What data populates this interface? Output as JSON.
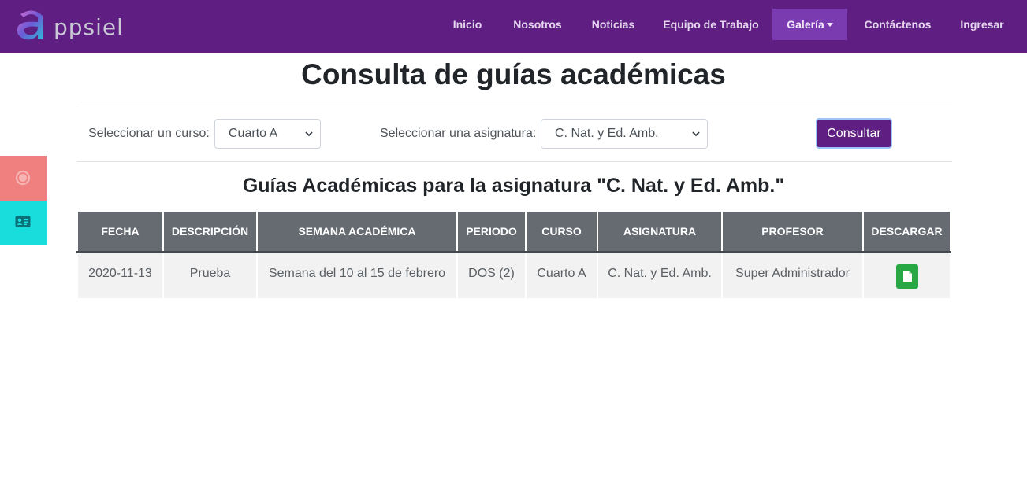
{
  "brand": {
    "logo_text": "ppsiel",
    "logo_letter": "a"
  },
  "nav": {
    "items": [
      {
        "label": "Inicio"
      },
      {
        "label": "Nosotros"
      },
      {
        "label": "Noticias"
      },
      {
        "label": "Equipo de Trabajo"
      },
      {
        "label": "Galería",
        "active": true,
        "dropdown": true
      },
      {
        "label": "Contáctenos"
      },
      {
        "label": "Ingresar"
      }
    ]
  },
  "side_buttons": [
    {
      "icon": "circle-icon",
      "color": "#f08080"
    },
    {
      "icon": "id-card-icon",
      "color": "#19dddd"
    }
  ],
  "page": {
    "title": "Consulta de guías académicas",
    "subtitle": "Guías Académicas para la asignatura \"C. Nat. y Ed. Amb.\""
  },
  "filters": {
    "curso_label": "Seleccionar un curso:",
    "curso_value": "Cuarto A",
    "asignatura_label": "Seleccionar una asignatura:",
    "asignatura_value": "C. Nat. y Ed. Amb.",
    "submit_label": "Consultar"
  },
  "table": {
    "headers": [
      "FECHA",
      "DESCRIPCIÓN",
      "SEMANA ACADÉMICA",
      "PERIODO",
      "CURSO",
      "ASIGNATURA",
      "PROFESOR",
      "DESCARGAR"
    ],
    "rows": [
      [
        "2020-11-13",
        "Prueba",
        "Semana del 10 al 15 de febrero",
        "DOS (2)",
        "Cuarto A",
        "C. Nat. y Ed. Amb.",
        "Super Administrador",
        ""
      ]
    ]
  },
  "colors": {
    "navbar": "#5f1f82",
    "nav_active": "#7b3bb0",
    "table_header": "#656b71",
    "download_button": "#28a745",
    "primary_button": "#5f1f82"
  }
}
